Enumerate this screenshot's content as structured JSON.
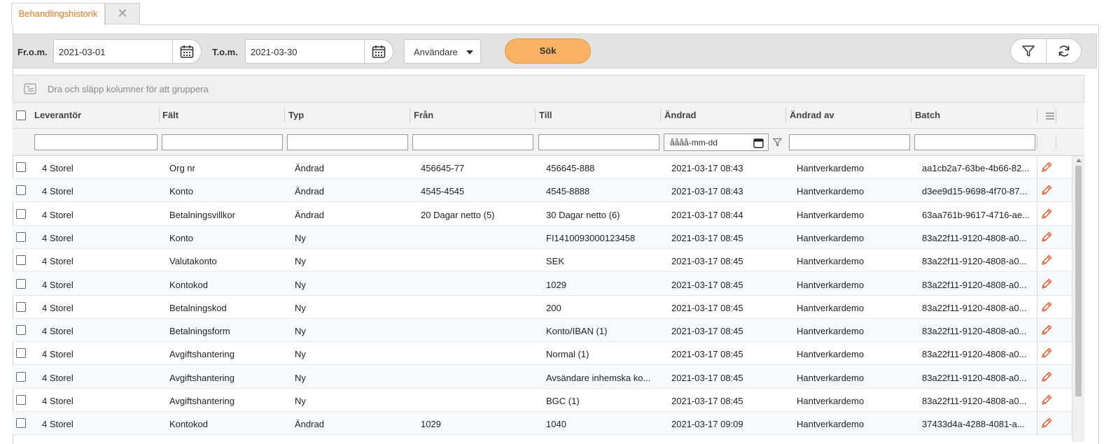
{
  "tabs": {
    "active_label": "Behandlingshistorik",
    "close_symbol": "✕"
  },
  "toolbar": {
    "from_label": "Fr.o.m.",
    "from_value": "2021-03-01",
    "to_label": "T.o.m.",
    "to_value": "2021-03-30",
    "user_dropdown": "Användare",
    "search_label": "Sök"
  },
  "grouping": {
    "hint": "Dra och släpp kolumner för att gruppera"
  },
  "columns": [
    "Leverantör",
    "Fält",
    "Typ",
    "Från",
    "Till",
    "Ändrad",
    "Ändrad av",
    "Batch"
  ],
  "filters": {
    "date_placeholder": "åååå-mm-dd"
  },
  "rows": [
    [
      "4 Storel",
      "Org nr",
      "Ändrad",
      "456645-77",
      "456645-888",
      "2021-03-17 08:43",
      "Hantverkardemo",
      "aa1cb2a7-63be-4b66-82..."
    ],
    [
      "4 Storel",
      "Konto",
      "Ändrad",
      "4545-4545",
      "4545-8888",
      "2021-03-17 08:43",
      "Hantverkardemo",
      "d3ee9d15-9698-4f70-87..."
    ],
    [
      "4 Storel",
      "Betalningsvillkor",
      "Ändrad",
      "20 Dagar netto (5)",
      "30 Dagar netto (6)",
      "2021-03-17 08:44",
      "Hantverkardemo",
      "63aa761b-9617-4716-ae..."
    ],
    [
      "4 Storel",
      "Konto",
      "Ny",
      "",
      "FI1410093000123458",
      "2021-03-17 08:45",
      "Hantverkardemo",
      "83a22f11-9120-4808-a0..."
    ],
    [
      "4 Storel",
      "Valutakonto",
      "Ny",
      "",
      "SEK",
      "2021-03-17 08:45",
      "Hantverkardemo",
      "83a22f11-9120-4808-a0..."
    ],
    [
      "4 Storel",
      "Kontokod",
      "Ny",
      "",
      "1029",
      "2021-03-17 08:45",
      "Hantverkardemo",
      "83a22f11-9120-4808-a0..."
    ],
    [
      "4 Storel",
      "Betalningskod",
      "Ny",
      "",
      "200",
      "2021-03-17 08:45",
      "Hantverkardemo",
      "83a22f11-9120-4808-a0..."
    ],
    [
      "4 Storel",
      "Betalningsform",
      "Ny",
      "",
      "Konto/IBAN (1)",
      "2021-03-17 08:45",
      "Hantverkardemo",
      "83a22f11-9120-4808-a0..."
    ],
    [
      "4 Storel",
      "Avgiftshantering",
      "Ny",
      "",
      "Normal (1)",
      "2021-03-17 08:45",
      "Hantverkardemo",
      "83a22f11-9120-4808-a0..."
    ],
    [
      "4 Storel",
      "Avgiftshantering",
      "Ny",
      "",
      "Avsändare inhemska ko...",
      "2021-03-17 08:45",
      "Hantverkardemo",
      "83a22f11-9120-4808-a0..."
    ],
    [
      "4 Storel",
      "Avgiftshantering",
      "Ny",
      "",
      "BGC (1)",
      "2021-03-17 08:45",
      "Hantverkardemo",
      "83a22f11-9120-4808-a0..."
    ],
    [
      "4 Storel",
      "Kontokod",
      "Ändrad",
      "1029",
      "1040",
      "2021-03-17 09:09",
      "Hantverkardemo",
      "37433d4a-4288-4081-a..."
    ]
  ],
  "colors": {
    "accent": "#e87722",
    "search_button": "#fbb264",
    "edit_icon": "#e05a2b"
  }
}
